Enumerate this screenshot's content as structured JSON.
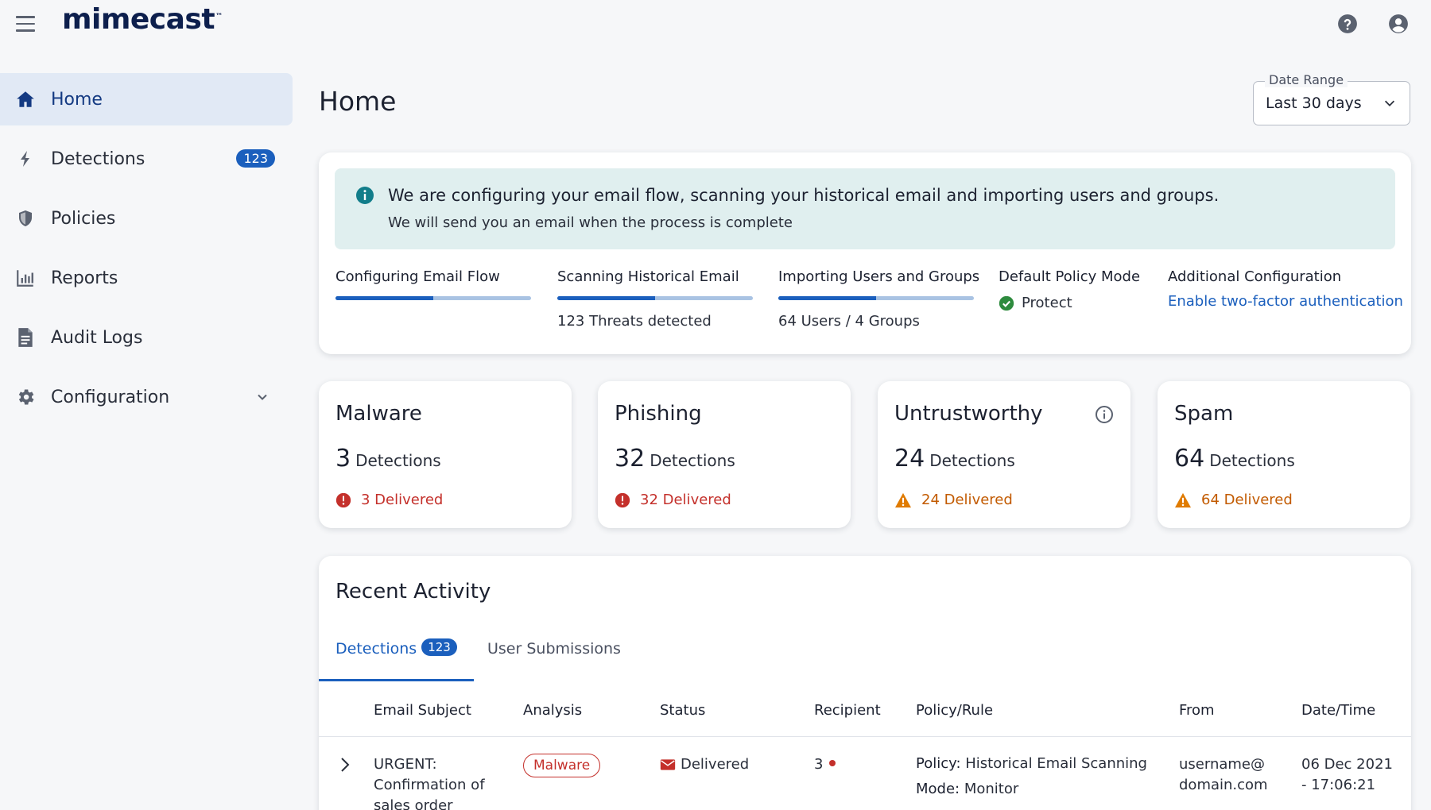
{
  "app": {
    "logo": "mimecast"
  },
  "sidebar": {
    "items": [
      {
        "label": "Home",
        "active": true
      },
      {
        "label": "Detections",
        "badge": "123"
      },
      {
        "label": "Policies"
      },
      {
        "label": "Reports"
      },
      {
        "label": "Audit Logs"
      },
      {
        "label": "Configuration",
        "expandable": true
      }
    ]
  },
  "page": {
    "title": "Home"
  },
  "date_range": {
    "label": "Date Range",
    "value": "Last 30 days"
  },
  "banner": {
    "title": "We are configuring your email flow, scanning your historical email and importing users and groups.",
    "subtitle": "We will send you an email when the process is complete"
  },
  "progress": {
    "email_flow": {
      "title": "Configuring Email Flow",
      "progress": 0.5
    },
    "historical": {
      "title": "Scanning Historical Email",
      "progress": 0.5,
      "sub": "123 Threats detected"
    },
    "import": {
      "title": "Importing Users and Groups",
      "progress": 0.5,
      "sub": "64 Users / 4 Groups"
    },
    "policy_mode": {
      "title": "Default Policy Mode",
      "value": "Protect"
    },
    "additional": {
      "title": "Additional Configuration",
      "link": "Enable two-factor authentication"
    }
  },
  "stats": [
    {
      "title": "Malware",
      "count": "3",
      "unit": "Detections",
      "delivered": "3 Delivered",
      "severity": "error"
    },
    {
      "title": "Phishing",
      "count": "32",
      "unit": "Detections",
      "delivered": "32 Delivered",
      "severity": "error"
    },
    {
      "title": "Untrustworthy",
      "count": "24",
      "unit": "Detections",
      "delivered": "24 Delivered",
      "severity": "warning",
      "info": true
    },
    {
      "title": "Spam",
      "count": "64",
      "unit": "Detections",
      "delivered": "64 Delivered",
      "severity": "warning"
    }
  ],
  "activity": {
    "title": "Recent Activity",
    "tabs": [
      {
        "label": "Detections",
        "badge": "123",
        "active": true
      },
      {
        "label": "User Submissions"
      }
    ],
    "columns": [
      "Email Subject",
      "Analysis",
      "Status",
      "Recipient",
      "Policy/Rule",
      "From",
      "Date/Time"
    ],
    "rows": [
      {
        "subject_line1": "URGENT:",
        "subject_line2": "Confirmation of",
        "subject_line3": "sales order",
        "analysis": "Malware",
        "status": "Delivered",
        "recipient": "3",
        "policy_label": "Policy:",
        "policy_value": "Historical Email Scanning",
        "mode_label": "Mode:",
        "mode_value": "Monitor",
        "from_line1": "username@",
        "from_line2": "domain.com",
        "date_line1": "06 Dec 2021",
        "date_line2": "- 17:06:21"
      }
    ]
  },
  "colors": {
    "accent": "#1b5fbd",
    "error": "#c4302b",
    "warning": "#e07b00",
    "success": "#2e8b3e",
    "banner_bg": "#e0efef",
    "nav_active_bg": "#e1e9f5"
  }
}
